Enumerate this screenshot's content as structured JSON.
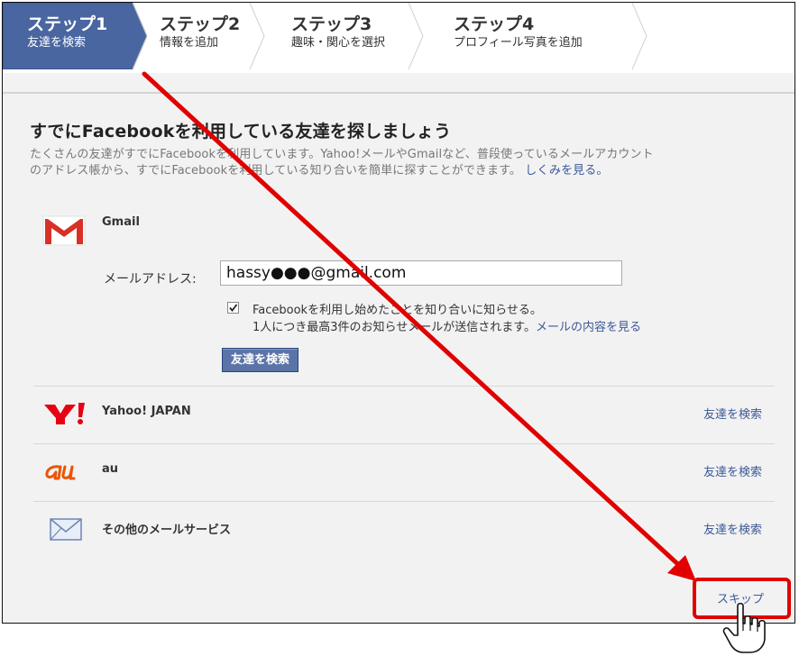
{
  "steps": [
    {
      "title": "ステップ1",
      "subtitle": "友達を検索",
      "active": true
    },
    {
      "title": "ステップ2",
      "subtitle": "情報を追加",
      "active": false
    },
    {
      "title": "ステップ3",
      "subtitle": "趣味・関心を選択",
      "active": false
    },
    {
      "title": "ステップ4",
      "subtitle": "プロフィール写真を追加",
      "active": false
    }
  ],
  "main": {
    "heading": "すでにFacebookを利用している友達を探しましょう",
    "description_line1": "たくさんの友達がすでにFacebookを利用しています。Yahoo!メールやGmailなど、普段使っているメールアカウント",
    "description_line2": "のアドレス帳から、すでにFacebookを利用している知り合いを簡単に探すことができます。",
    "how_it_works_link": "しくみを見る。"
  },
  "gmail": {
    "name": "Gmail",
    "email_label": "メールアドレス:",
    "email_value": "hassy●●●@gmail.com",
    "notify_checked": true,
    "notify_label": "Facebookを利用し始めたことを知り合いに知らせる。",
    "notify_note": "1人につき最高3件のお知らせメールが送信されます。",
    "notify_preview_link": "メールの内容を見る",
    "search_button": "友達を検索"
  },
  "services": [
    {
      "name": "Yahoo! JAPAN",
      "action": "友達を検索",
      "icon": "yahoo-logo-icon"
    },
    {
      "name": "au",
      "action": "友達を検索",
      "icon": "au-logo-icon"
    },
    {
      "name": "その他のメールサービス",
      "action": "友達を検索",
      "icon": "envelope-icon"
    }
  ],
  "footer": {
    "skip_label": "スキップ"
  },
  "colors": {
    "accent": "#3b5998",
    "annotation": "#e00000",
    "active_step": "#4a66a0"
  }
}
